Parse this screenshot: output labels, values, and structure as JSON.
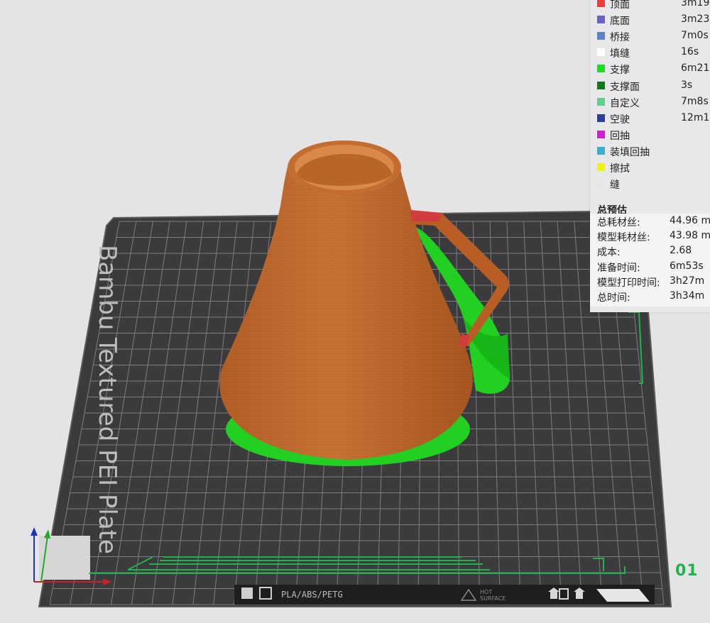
{
  "legend": {
    "items": [
      {
        "name": "顶面",
        "time": "3m19",
        "color": "#f03c3c"
      },
      {
        "name": "底面",
        "time": "3m23",
        "color": "#6b5fc9"
      },
      {
        "name": "桥接",
        "time": "7m0s",
        "color": "#5b83c7"
      },
      {
        "name": "填缝",
        "time": "16s",
        "color": "#ffffff"
      },
      {
        "name": "支撑",
        "time": "6m21",
        "color": "#19e019"
      },
      {
        "name": "支撑面",
        "time": "3s",
        "color": "#0f7a1c"
      },
      {
        "name": "自定义",
        "time": "7m8s",
        "color": "#5fcf8c"
      },
      {
        "name": "空驶",
        "time": "12m1",
        "color": "#2d3f9e"
      },
      {
        "name": "回抽",
        "time": "",
        "color": "#d21ed2"
      },
      {
        "name": "装填回抽",
        "time": "",
        "color": "#3aaed1"
      },
      {
        "name": "擦拭",
        "time": "",
        "color": "#f2f205"
      },
      {
        "name": "缝",
        "time": "",
        "color": "#e6e6e6"
      }
    ],
    "summary_title": "总预估",
    "summary": [
      {
        "label": "总耗材丝:",
        "value": "44.96 m"
      },
      {
        "label": "模型耗材丝:",
        "value": "43.98 m"
      },
      {
        "label": "成本:",
        "value": "2.68"
      },
      {
        "label": "准备时间:",
        "value": "6m53s"
      },
      {
        "label": "模型打印时间:",
        "value": "3h27m"
      },
      {
        "label": "总时间:",
        "value": "3h34m"
      }
    ]
  },
  "plate": {
    "brand_text": "Bambu Textured PEI Plate",
    "material_text": "PLA/ABS/PETG",
    "hot_surface_line1": "HOT",
    "hot_surface_line2": "SURFACE",
    "number": "01"
  },
  "colors": {
    "model": "#c06a2e",
    "support": "#1ed21e",
    "plate": "#3b3b3d",
    "grid": "#9a9a9a",
    "accent_green": "#1fb34a"
  },
  "icons": {
    "axis": "xyz-axis-icon",
    "material": "material-icon",
    "hot_surface": "hot-surface-warning-icon",
    "upload": "upload-icon"
  }
}
